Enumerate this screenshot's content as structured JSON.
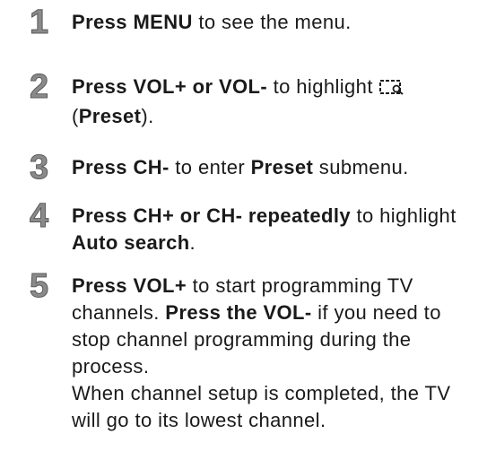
{
  "steps": [
    {
      "number": "1",
      "b1": "Press MENU",
      "t1": " to see the menu."
    },
    {
      "number": "2",
      "b1": "Press VOL+ or VOL-",
      "t1": " to highlight",
      "icon": "preset-icon",
      "t2": "(",
      "b2": "Preset",
      "t3": ")."
    },
    {
      "number": "3",
      "b1": "Press CH-",
      "t1": " to enter ",
      "b2": "Preset",
      "t2": " submenu."
    },
    {
      "number": "4",
      "b1": "Press CH+ or CH- repeatedly",
      "t1": " to highlight ",
      "b2": "Auto search",
      "t2": "."
    },
    {
      "number": "5",
      "b1": "Press VOL+",
      "t1": " to start programming TV channels. ",
      "b2": "Press the VOL-",
      "t2": " if you need to stop channel programming during the process.",
      "t3": "When channel setup is completed, the TV will go to its lowest channel."
    }
  ]
}
